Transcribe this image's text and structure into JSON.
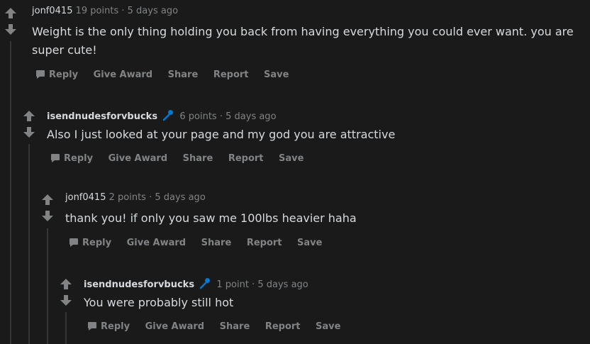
{
  "comments": [
    {
      "author": "jonf0415",
      "points": "19 points",
      "separator": "·",
      "time": "5 days ago",
      "body": "Weight is the only thing holding you back from having everything you could ever want. you are super cute!",
      "actions": [
        "Reply",
        "Give Award",
        "Share",
        "Report",
        "Save"
      ]
    },
    {
      "author": "isendnudesforvbucks",
      "points": "6 points",
      "separator": "·",
      "time": "5 days ago",
      "body": "Also I just looked at your page and my god you are attractive",
      "actions": [
        "Reply",
        "Give Award",
        "Share",
        "Report",
        "Save"
      ]
    },
    {
      "author": "jonf0415",
      "points": "2 points",
      "separator": "·",
      "time": "5 days ago",
      "body": "thank you! if only you saw me 100lbs heavier haha",
      "actions": [
        "Reply",
        "Give Award",
        "Share",
        "Report",
        "Save"
      ]
    },
    {
      "author": "isendnudesforvbucks",
      "points": "1 point",
      "separator": "·",
      "time": "5 days ago",
      "body": "You were probably still hot",
      "actions": [
        "Reply",
        "Give Award",
        "Share",
        "Report",
        "Save"
      ]
    }
  ],
  "icons": {
    "upvote": "arrow-up-icon",
    "downvote": "arrow-down-icon",
    "reply": "comment-bubble-icon",
    "flair": "microphone-icon"
  },
  "colors": {
    "background": "#1a1a1b",
    "text": "#d7dadc",
    "muted": "#818384",
    "thread_line": "#343536",
    "flair": "#0079d3"
  }
}
